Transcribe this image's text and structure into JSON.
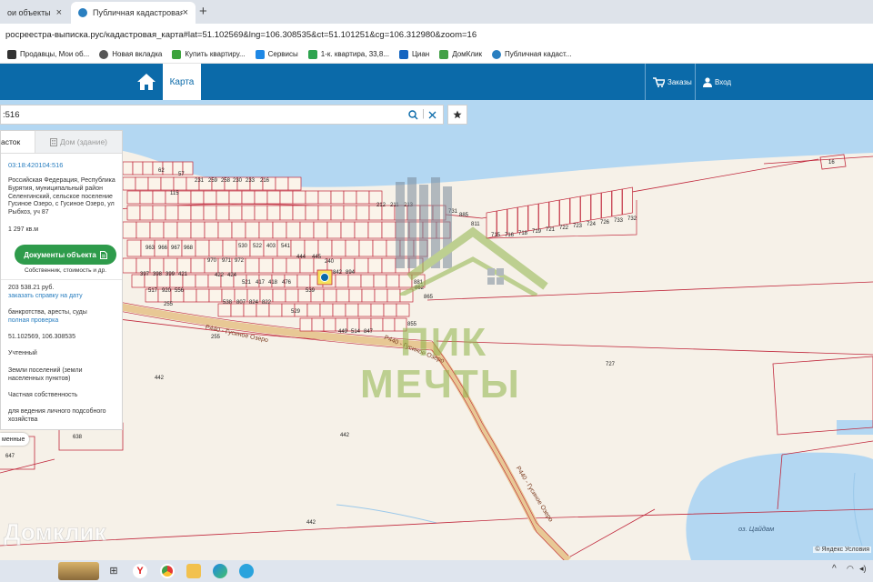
{
  "browser": {
    "tabs": [
      {
        "label": "ои объекты",
        "active": false
      },
      {
        "label": "Публичная кадастровая карта",
        "active": true
      }
    ],
    "new_tab_symbol": "+",
    "close_symbol": "×",
    "address": "росреестра-выписка.рус/кадастровая_карта#lat=51.102569&lng=106.308535&ct=51.101251&cg=106.312980&zoom=16",
    "bookmarks": [
      {
        "label": "Продавцы, Мои об...",
        "color": "#333333"
      },
      {
        "label": "Новая вкладка",
        "color": "#555555"
      },
      {
        "label": "Купить квартиру...",
        "color": "#3ca33c"
      },
      {
        "label": "Сервисы",
        "color": "#1e88e5"
      },
      {
        "label": "1-к. квартира, 33,8...",
        "color": "#2ea44f"
      },
      {
        "label": "Циан",
        "color": "#1565c0"
      },
      {
        "label": "ДомКлик",
        "color": "#43a047"
      },
      {
        "label": "Публичная кадаст...",
        "color": "#2a7fc0"
      }
    ]
  },
  "header": {
    "map_tab": "Карта",
    "orders": "Заказы",
    "login": "Вход"
  },
  "search": {
    "value": ":516"
  },
  "panel": {
    "tab_parcel": "асток",
    "tab_building": "Дом (здание)",
    "cadastral_number": "03:18:420104:516",
    "address": "Российская Федерация, Республика Бурятия, муниципальный район Селенгинский, сельское поселение Гусиное Озеро, с Гусиное Озеро, ул Рыбхоз, уч 87",
    "area": "1 297 кв.м",
    "docs_button": "Документы объекта",
    "docs_note": "Собственник, стоимость и др.",
    "value": "203 538.21 руб.",
    "order_link": "заказать справку на дату",
    "checks": "банкротства, аресты, суды",
    "full_check_link": "полная проверка",
    "coords": "51.102569, 106.308535",
    "status": "Учтенный",
    "category": "Земли поселений (земли населенных пунктов)",
    "ownership": "Частная собственность",
    "usage": "для ведения личного подсобного хозяйства",
    "show_more": "менные"
  },
  "map": {
    "road_labels": [
      "Р440 - Гусиное Озеро",
      "Р440 - Гусиное Озеро",
      "Р440 - Гусиное Озеро"
    ],
    "lake_label": "оз. Цайдам",
    "parcel_labels": [
      "727",
      "442",
      "442",
      "442",
      "255",
      "255",
      "638",
      "647",
      "16",
      "62",
      "57",
      "115",
      "231",
      "259",
      "258",
      "230",
      "233",
      "216",
      "212",
      "211",
      "213",
      "963",
      "966",
      "967",
      "968",
      "970",
      "971",
      "972",
      "530",
      "522",
      "403",
      "541",
      "444",
      "445",
      "240",
      "842",
      "894",
      "397",
      "398",
      "399",
      "421",
      "422",
      "424",
      "521",
      "417",
      "418",
      "476",
      "517",
      "920",
      "556",
      "538",
      "807",
      "824",
      "822",
      "529",
      "539",
      "449",
      "514",
      "847",
      "855",
      "862",
      "865",
      "881",
      "811",
      "885",
      "731",
      "732",
      "733",
      "726",
      "724",
      "723",
      "722",
      "721",
      "719",
      "718",
      "716",
      "715",
      "714",
      "713",
      "712",
      "529"
    ],
    "watermark_top": "ПИК",
    "watermark_bottom": "МЕЧТЫ",
    "watermark_corner": "Домклик",
    "copyright": "© Яндекс Условия"
  },
  "colors": {
    "header_blue": "#0b6aa9",
    "water": "#b3d7f2",
    "land": "#f6f1e8",
    "parcel_line": "#c0273b",
    "road": "#e8c895",
    "button_green": "#2e9b4b"
  }
}
